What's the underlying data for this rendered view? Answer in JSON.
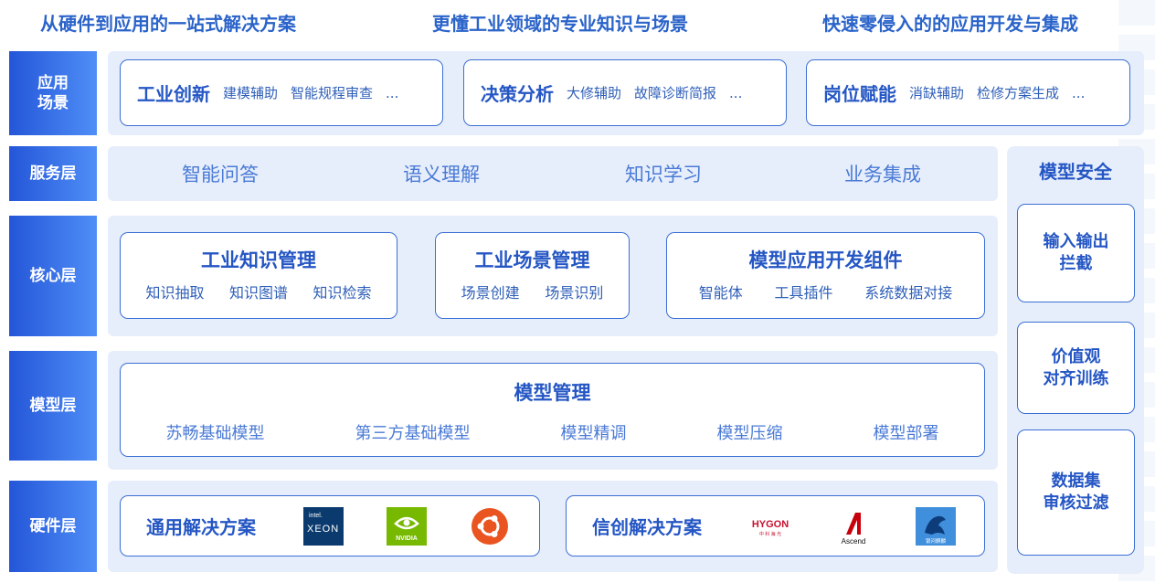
{
  "slogans": [
    "从硬件到应用的一站式解决方案",
    "更懂工业领域的专业知识与场景",
    "快速零侵入的的应用开发与集成"
  ],
  "layers": {
    "app": {
      "label_line1": "应用",
      "label_line2": "场景"
    },
    "service": {
      "label": "服务层"
    },
    "core": {
      "label": "核心层"
    },
    "model": {
      "label": "模型层"
    },
    "hardware": {
      "label": "硬件层"
    }
  },
  "app_scenarios": [
    {
      "title": "工业创新",
      "items": [
        "建模辅助",
        "智能规程审查",
        "..."
      ]
    },
    {
      "title": "决策分析",
      "items": [
        "大修辅助",
        "故障诊断简报",
        "..."
      ]
    },
    {
      "title": "岗位赋能",
      "items": [
        "消缺辅助",
        "检修方案生成",
        "..."
      ]
    }
  ],
  "services": [
    "智能问答",
    "语义理解",
    "知识学习",
    "业务集成"
  ],
  "core_modules": [
    {
      "title": "工业知识管理",
      "items": [
        "知识抽取",
        "知识图谱",
        "知识检索"
      ]
    },
    {
      "title": "工业场景管理",
      "items": [
        "场景创建",
        "场景识别"
      ]
    },
    {
      "title": "模型应用开发组件",
      "items": [
        "智能体",
        "工具插件",
        "系统数据对接"
      ]
    }
  ],
  "model_management": {
    "title": "模型管理",
    "items": [
      "苏畅基础模型",
      "第三方基础模型",
      "模型精调",
      "模型压缩",
      "模型部署"
    ]
  },
  "hardware": {
    "general": {
      "title": "通用解决方案",
      "logos": [
        {
          "icon": "intel-xeon-logo",
          "line1": "intel.",
          "line2": "XEON"
        },
        {
          "icon": "nvidia-logo",
          "text": "NVIDIA"
        },
        {
          "icon": "ubuntu-logo"
        }
      ]
    },
    "xinchuang": {
      "title": "信创解决方案",
      "logos": [
        {
          "icon": "hygon-logo",
          "text": "HYGON",
          "sub": "中 科 海 光"
        },
        {
          "icon": "ascend-logo",
          "text": "Ascend"
        },
        {
          "icon": "kylin-logo",
          "text": "银河麒麟"
        }
      ]
    }
  },
  "model_security": {
    "title": "模型安全",
    "items": [
      {
        "line1": "输入输出",
        "line2": "拦截"
      },
      {
        "line1": "价值观",
        "line2": "对齐训练"
      },
      {
        "line1": "数据集",
        "line2": "审核过滤"
      }
    ]
  },
  "colors": {
    "primary": "#2456c4",
    "label_gradient_start": "#2456d8",
    "label_gradient_end": "#4f8ef7",
    "band": "#e7eefb",
    "card_border": "#3b6fd4"
  }
}
